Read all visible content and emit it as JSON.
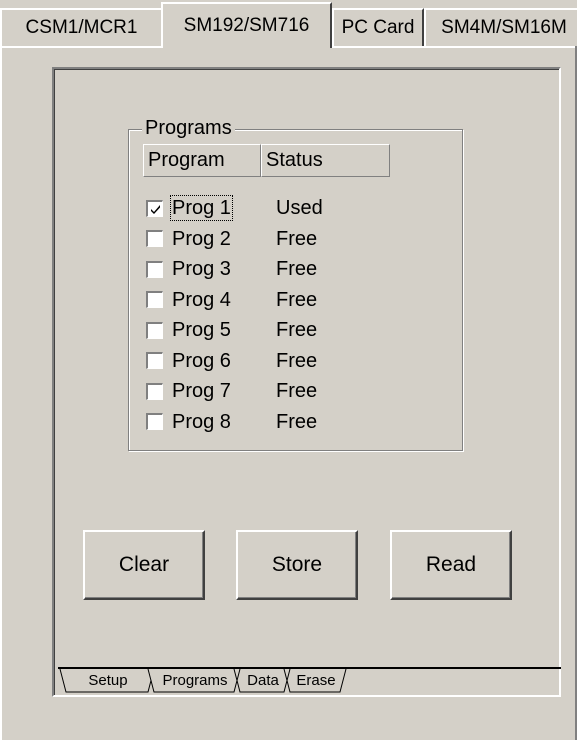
{
  "top_tabs": [
    {
      "label": "CSM1/MCR1",
      "active": false
    },
    {
      "label": "SM192/SM716",
      "active": true
    },
    {
      "label": "PC Card",
      "active": false
    },
    {
      "label": "SM4M/SM16M",
      "active": false
    }
  ],
  "programs_group": {
    "title": "Programs",
    "columns": [
      "Program",
      "Status"
    ],
    "rows": [
      {
        "name": "Prog 1",
        "status": "Used",
        "checked": true
      },
      {
        "name": "Prog 2",
        "status": "Free",
        "checked": false
      },
      {
        "name": "Prog 3",
        "status": "Free",
        "checked": false
      },
      {
        "name": "Prog 4",
        "status": "Free",
        "checked": false
      },
      {
        "name": "Prog 5",
        "status": "Free",
        "checked": false
      },
      {
        "name": "Prog 6",
        "status": "Free",
        "checked": false
      },
      {
        "name": "Prog 7",
        "status": "Free",
        "checked": false
      },
      {
        "name": "Prog 8",
        "status": "Free",
        "checked": false
      }
    ]
  },
  "buttons": {
    "clear": "Clear",
    "store": "Store",
    "read": "Read"
  },
  "bottom_tabs": [
    {
      "label": "Setup",
      "active": false
    },
    {
      "label": "Programs",
      "active": true
    },
    {
      "label": "Data",
      "active": false
    },
    {
      "label": "Erase",
      "active": false
    }
  ]
}
